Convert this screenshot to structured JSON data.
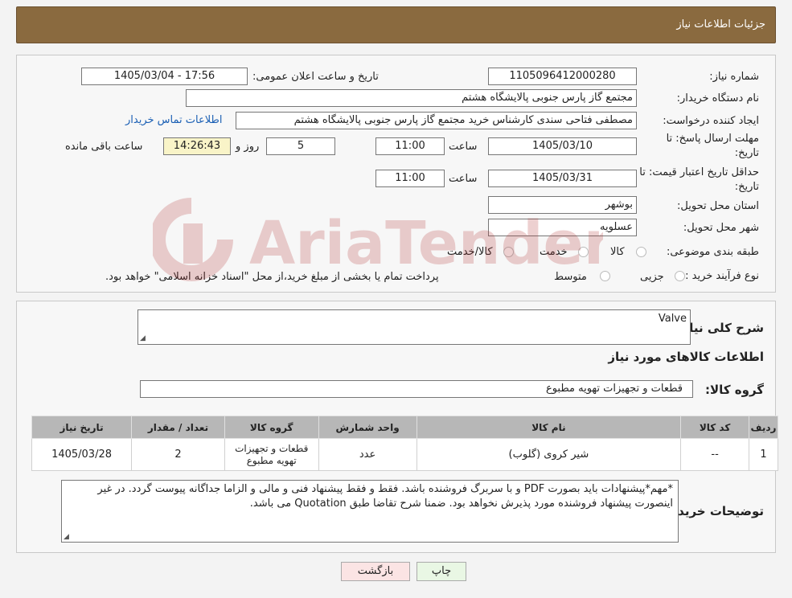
{
  "header": {
    "title": "جزئیات اطلاعات نیاز"
  },
  "form": {
    "need_number_label": "شماره نیاز:",
    "need_number": "1105096412000280",
    "announce_label": "تاریخ و ساعت اعلان عمومی:",
    "announce_value": "1405/03/04 - 17:56",
    "buyer_label": "نام دستگاه خریدار:",
    "buyer_value": "مجتمع گاز پارس جنوبی  پالایشگاه هشتم",
    "creator_label": "ایجاد کننده درخواست:",
    "creator_value": "مصطفی فتاحی سندی کارشناس خرید مجتمع گاز پارس جنوبی  پالایشگاه هشتم",
    "contact_link": "اطلاعات تماس خریدار",
    "deadline_label_1": "مهلت ارسال پاسخ: تا",
    "deadline_label_2": "تاریخ:",
    "deadline_date": "1405/03/10",
    "time_label": "ساعت",
    "deadline_time": "11:00",
    "days_value": "5",
    "days_label": "روز و",
    "remaining_time": "14:26:43",
    "remaining_label": "ساعت باقی مانده",
    "validity_label_1": "حداقل تاریخ اعتبار قیمت: تا",
    "validity_label_2": "تاریخ:",
    "validity_date": "1405/03/31",
    "validity_time": "11:00",
    "province_label": "استان محل تحویل:",
    "province_value": "بوشهر",
    "city_label": "شهر محل تحویل:",
    "city_value": "عسلویه",
    "category_label": "طبقه بندی موضوعی:",
    "category_options": [
      "کالا",
      "خدمت",
      "کالا/خدمت"
    ],
    "process_label": "نوع فرآیند خرید :",
    "process_options": [
      "جزیی",
      "متوسط"
    ],
    "process_note": "پرداخت تمام یا بخشی از مبلغ خرید،از محل \"اسناد خزانه اسلامی\" خواهد بود."
  },
  "details": {
    "summary_label": "شرح کلی نیاز:",
    "summary_value": "Valve",
    "goods_info_title": "اطلاعات کالاهای مورد نیاز",
    "goods_group_label": "گروه کالا:",
    "goods_group_value": "قطعات و تجهیزات تهویه مطبوع",
    "table": {
      "headers": [
        "ردیف",
        "کد کالا",
        "نام کالا",
        "واحد شمارش",
        "گروه کالا",
        "تعداد / مقدار",
        "تاریخ نیاز"
      ],
      "rows": [
        [
          "1",
          "--",
          "شیر کروی (گلوب)",
          "عدد",
          "قطعات و تجهیزات تهویه مطبوع",
          "2",
          "1405/03/28"
        ]
      ]
    },
    "buyer_notes_label": "توضیحات خریدار:",
    "buyer_notes_value": "*مهم*پیشنهادات باید بصورت PDF و با سربرگ فروشنده باشد. فقط و فقط پیشنهاد فنی و مالی و الزاما جداگانه پیوست گردد. در غیر اینصورت پیشنهاد فروشنده مورد پذیرش نخواهد بود. ضمنا شرح تقاضا طبق Quotation می باشد."
  },
  "buttons": {
    "print": "چاپ",
    "back": "بازگشت"
  },
  "watermark": {
    "text": "AriaTender.neT",
    "color": "#b03030"
  }
}
